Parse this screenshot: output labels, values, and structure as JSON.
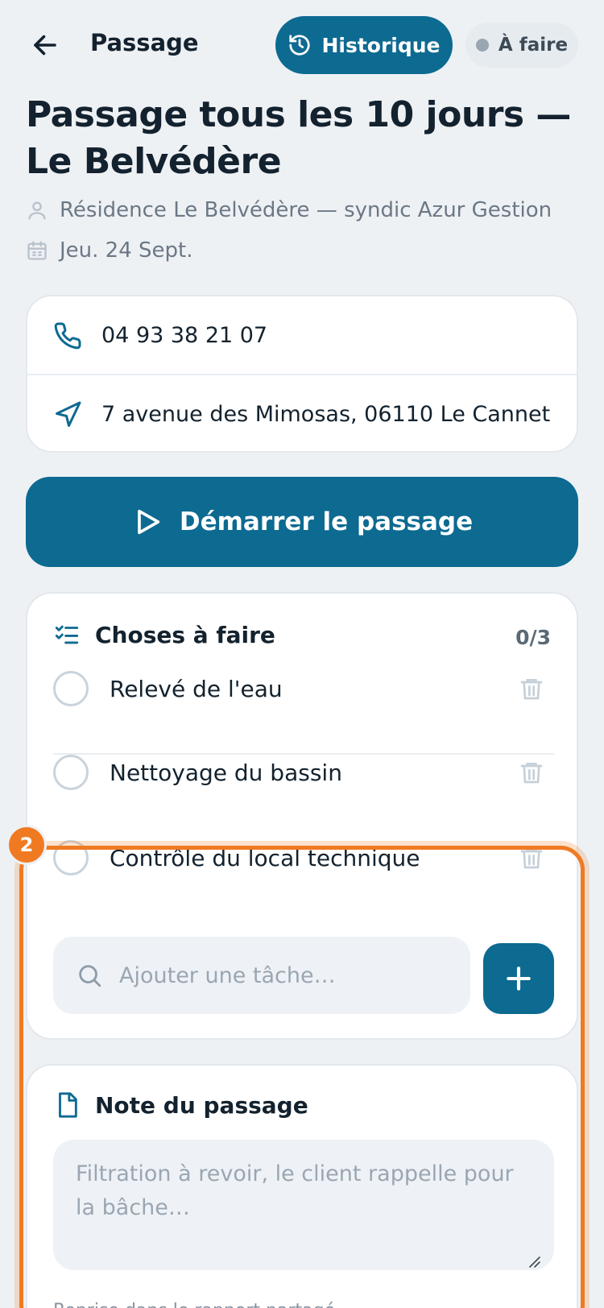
{
  "header": {
    "back_icon": "arrow-left-icon",
    "title": "Passage",
    "history_label": "Historique",
    "history_icon": "history-icon",
    "status_label": "À faire"
  },
  "page": {
    "title": "Passage tous les 10 jours — Le Belvédère",
    "client": "Résidence Le Belvédère — syndic Azur Gestion",
    "date": "Jeu. 24 Sept."
  },
  "contact": {
    "phone": "04 93 38 21 07",
    "address": "7 avenue des Mimosas, 06110 Le Cannet"
  },
  "start_button": {
    "label": "Démarrer le passage"
  },
  "todo": {
    "title": "Choses à faire",
    "count": "0/3",
    "tasks": [
      {
        "label": "Relevé de l'eau",
        "done": false
      },
      {
        "label": "Nettoyage du bassin",
        "done": false
      },
      {
        "label": "Contrôle du local technique",
        "done": false
      }
    ],
    "add_placeholder": "Ajouter une tâche…"
  },
  "note": {
    "title": "Note du passage",
    "placeholder": "Filtration à revoir, le client rappelle pour la bâche…",
    "hint": "Reprise dans le rapport partagé"
  },
  "annotation": {
    "badge": "2"
  },
  "colors": {
    "primary": "#0d6a91",
    "highlight": "#f07a22",
    "background": "#eef1f4"
  }
}
